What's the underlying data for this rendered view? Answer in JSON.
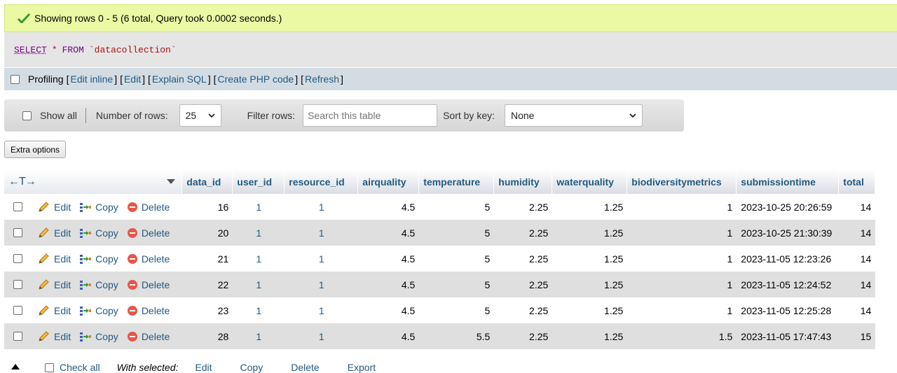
{
  "message": "Showing rows 0 - 5 (6 total, Query took 0.0002 seconds.)",
  "sql": {
    "select": "SELECT",
    "star": "*",
    "from": "FROM",
    "table": "`datacollection`"
  },
  "profiling": {
    "label": "Profiling",
    "links": [
      "Edit inline",
      "Edit",
      "Explain SQL",
      "Create PHP code",
      "Refresh"
    ]
  },
  "nav": {
    "show_all": "Show all",
    "rows_label": "Number of rows:",
    "rows_value": "25",
    "filter_label": "Filter rows:",
    "filter_placeholder": "Search this table",
    "sort_label": "Sort by key:",
    "sort_value": "None"
  },
  "extra_options": "Extra options",
  "table": {
    "arrows": "←T→",
    "columns": [
      "data_id",
      "user_id",
      "resource_id",
      "airquality",
      "temperature",
      "humidity",
      "waterquality",
      "biodiversitymetrics",
      "submissiontime",
      "total"
    ],
    "actions": {
      "edit": "Edit",
      "copy": "Copy",
      "delete": "Delete"
    },
    "rows": [
      [
        "16",
        "1",
        "1",
        "4.5",
        "5",
        "2.25",
        "1.25",
        "1",
        "2023-10-25 20:26:59",
        "14"
      ],
      [
        "20",
        "1",
        "1",
        "4.5",
        "5",
        "2.25",
        "1.25",
        "1",
        "2023-10-25 21:30:39",
        "14"
      ],
      [
        "21",
        "1",
        "1",
        "4.5",
        "5",
        "2.25",
        "1.25",
        "1",
        "2023-11-05 12:23:26",
        "14"
      ],
      [
        "22",
        "1",
        "1",
        "4.5",
        "5",
        "2.25",
        "1.25",
        "1",
        "2023-11-05 12:24:52",
        "14"
      ],
      [
        "23",
        "1",
        "1",
        "4.5",
        "5",
        "2.25",
        "1.25",
        "1",
        "2023-11-05 12:25:28",
        "14"
      ],
      [
        "28",
        "1",
        "1",
        "4.5",
        "5.5",
        "2.25",
        "1.25",
        "1.5",
        "2023-11-05 17:47:43",
        "15"
      ]
    ]
  },
  "bottom": {
    "check_all": "Check all",
    "with_selected": "With selected:",
    "edit": "Edit",
    "copy": "Copy",
    "delete": "Delete",
    "export": "Export"
  }
}
